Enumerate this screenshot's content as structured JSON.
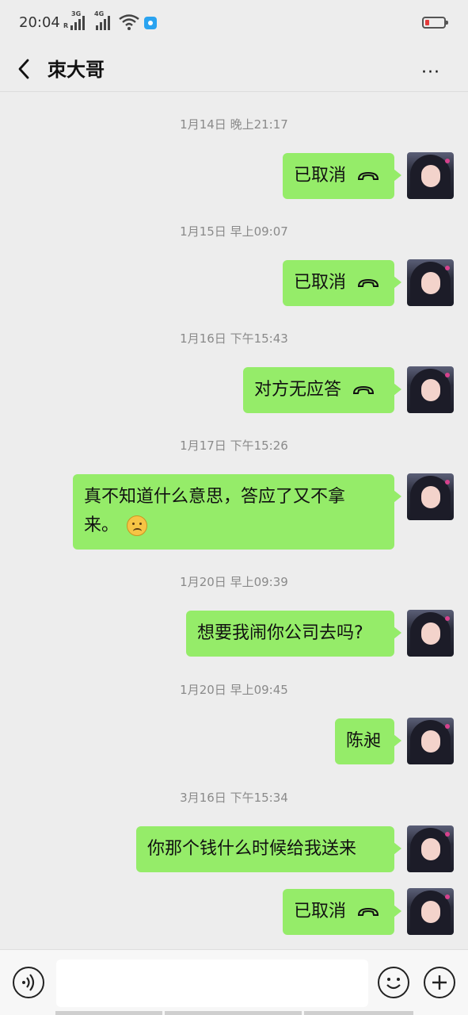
{
  "status_bar": {
    "time": "20:04",
    "signal1_label": "3G",
    "signal1_sub": "R",
    "signal2_label": "4G",
    "battery_color": "#e43b3b"
  },
  "header": {
    "title": "朿大哥",
    "back_icon": "chevron-left-icon",
    "more_icon": "more-dots-icon",
    "more_label": "···"
  },
  "messages": [
    {
      "timestamp": "1月14日 晚上21:17",
      "text": "已取消",
      "type": "call-cancelled"
    },
    {
      "timestamp": "1月15日 早上09:07",
      "text": "已取消",
      "type": "call-cancelled"
    },
    {
      "timestamp": "1月16日 下午15:43",
      "text": "对方无应答",
      "type": "call-no-answer"
    },
    {
      "timestamp": "1月17日 下午15:26",
      "text_line1": "真不知道什么意思，答应了又不拿",
      "text_line2": "来。",
      "emoji": "frown-emoji",
      "type": "text"
    },
    {
      "timestamp": "1月20日 早上09:39",
      "text": "想要我闹你公司去吗?",
      "type": "text"
    },
    {
      "timestamp": "1月20日 早上09:45",
      "text": "陈昶",
      "type": "text"
    },
    {
      "timestamp": "3月16日 下午15:34",
      "text": "你那个钱什么时候给我送来",
      "type": "text"
    },
    {
      "timestamp": "",
      "text": "已取消",
      "type": "call-cancelled"
    }
  ],
  "input_bar": {
    "voice_icon": "voice-icon",
    "emoji_icon": "emoji-icon",
    "plus_icon": "plus-icon",
    "input_value": ""
  },
  "colors": {
    "bubble": "#95ec69",
    "background": "#ededed"
  }
}
